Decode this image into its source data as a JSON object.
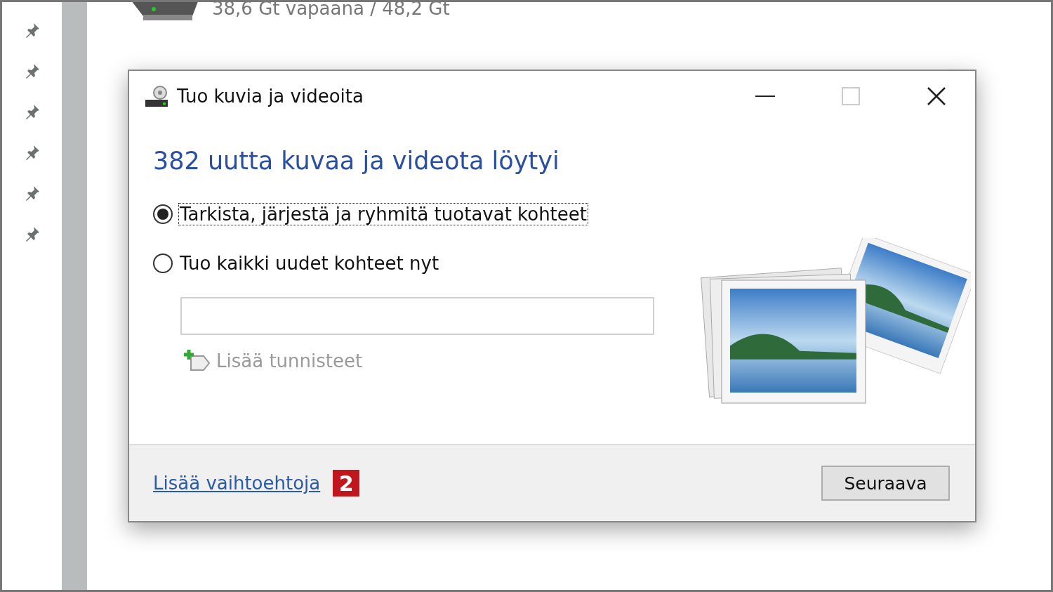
{
  "background_window": {
    "drive_free_space": "38,6 Gt vapaana / 48,2 Gt"
  },
  "dialog": {
    "title": "Tuo kuvia ja videoita",
    "heading": "382 uutta kuvaa ja videota löytyi",
    "options": [
      {
        "label": "Tarkista, järjestä ja ryhmitä tuotavat kohteet",
        "selected": true
      },
      {
        "label": "Tuo kaikki uudet kohteet nyt",
        "selected": false
      }
    ],
    "add_tags": {
      "label": "Lisää tunnisteet",
      "disabled": true
    },
    "more_options_link": "Lisää vaihtoehtoja",
    "badge": "2",
    "next_button": "Seuraava"
  }
}
